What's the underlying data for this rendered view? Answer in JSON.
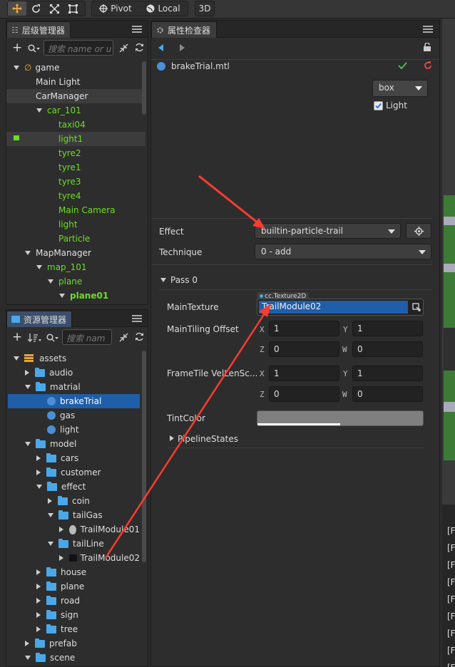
{
  "toolbar": {
    "pivot": "Pivot",
    "local": "Local",
    "mode3d": "3D"
  },
  "hierarchy": {
    "title": "层级管理器",
    "search_placeholder": "搜索 name or u",
    "nodes": [
      {
        "label": "game",
        "depth": 0,
        "arrow": "down",
        "color": "white",
        "icon": "fire"
      },
      {
        "label": "Main Light",
        "depth": 1,
        "arrow": "",
        "color": "white"
      },
      {
        "label": "CarManager",
        "depth": 1,
        "arrow": "",
        "color": "white",
        "state": "sel"
      },
      {
        "label": "car_101",
        "depth": 2,
        "arrow": "down",
        "color": "green"
      },
      {
        "label": "taxi04",
        "depth": 3,
        "arrow": "",
        "color": "green"
      },
      {
        "label": "light1",
        "depth": 3,
        "arrow": "",
        "color": "green",
        "state": "sel",
        "lock": true
      },
      {
        "label": "tyre2",
        "depth": 3,
        "arrow": "",
        "color": "green"
      },
      {
        "label": "tyre1",
        "depth": 3,
        "arrow": "",
        "color": "green"
      },
      {
        "label": "tyre3",
        "depth": 3,
        "arrow": "",
        "color": "green"
      },
      {
        "label": "tyre4",
        "depth": 3,
        "arrow": "",
        "color": "green"
      },
      {
        "label": "Main Camera",
        "depth": 3,
        "arrow": "",
        "color": "green"
      },
      {
        "label": "light",
        "depth": 3,
        "arrow": "",
        "color": "green"
      },
      {
        "label": "Particle",
        "depth": 3,
        "arrow": "",
        "color": "green"
      },
      {
        "label": "MapManager",
        "depth": 1,
        "arrow": "down",
        "color": "white"
      },
      {
        "label": "map_101",
        "depth": 2,
        "arrow": "down",
        "color": "green"
      },
      {
        "label": "plane",
        "depth": 3,
        "arrow": "down",
        "color": "green"
      },
      {
        "label": "plane01",
        "depth": 4,
        "arrow": "down",
        "color": "green"
      }
    ]
  },
  "assets": {
    "title": "资源管理器",
    "search_placeholder": "搜索 nam",
    "nodes": [
      {
        "label": "assets",
        "depth": 0,
        "arrow": "down",
        "icon": "db"
      },
      {
        "label": "audio",
        "depth": 1,
        "arrow": "right",
        "icon": "folder"
      },
      {
        "label": "matrial",
        "depth": 1,
        "arrow": "down",
        "icon": "folder"
      },
      {
        "label": "brakeTrial",
        "depth": 2,
        "arrow": "",
        "icon": "ball",
        "state": "blue"
      },
      {
        "label": "gas",
        "depth": 2,
        "arrow": "",
        "icon": "ball"
      },
      {
        "label": "light",
        "depth": 2,
        "arrow": "",
        "icon": "ball"
      },
      {
        "label": "model",
        "depth": 1,
        "arrow": "down",
        "icon": "folder"
      },
      {
        "label": "cars",
        "depth": 2,
        "arrow": "right",
        "icon": "folder"
      },
      {
        "label": "customer",
        "depth": 2,
        "arrow": "right",
        "icon": "folder"
      },
      {
        "label": "effect",
        "depth": 2,
        "arrow": "down",
        "icon": "folder"
      },
      {
        "label": "coin",
        "depth": 3,
        "arrow": "right",
        "icon": "folder"
      },
      {
        "label": "tailGas",
        "depth": 3,
        "arrow": "down",
        "icon": "folder"
      },
      {
        "label": "TrailModule01",
        "depth": 4,
        "arrow": "right",
        "icon": "smoke"
      },
      {
        "label": "tailLine",
        "depth": 3,
        "arrow": "down",
        "icon": "folder"
      },
      {
        "label": "TrailModule02",
        "depth": 4,
        "arrow": "right",
        "icon": "black"
      },
      {
        "label": "house",
        "depth": 2,
        "arrow": "right",
        "icon": "folder"
      },
      {
        "label": "plane",
        "depth": 2,
        "arrow": "right",
        "icon": "folder"
      },
      {
        "label": "road",
        "depth": 2,
        "arrow": "right",
        "icon": "folder"
      },
      {
        "label": "sign",
        "depth": 2,
        "arrow": "right",
        "icon": "folder"
      },
      {
        "label": "tree",
        "depth": 2,
        "arrow": "right",
        "icon": "folder"
      },
      {
        "label": "prefab",
        "depth": 1,
        "arrow": "right",
        "icon": "folder"
      },
      {
        "label": "scene",
        "depth": 1,
        "arrow": "down",
        "icon": "folder"
      }
    ]
  },
  "inspector": {
    "title": "属性检查器",
    "file": "brakeTrial.mtl",
    "preview_mesh": "box",
    "preview_light": "Light",
    "effect_label": "Effect",
    "effect_value": "builtin-particle-trail",
    "technique_label": "Technique",
    "technique_value": "0 - add",
    "pass_label": "Pass 0",
    "main_texture_label": "MainTexture",
    "texture_type": "cc.Texture2D",
    "main_texture_value": "TrailModule02",
    "tiling_label": "MainTiling Offset",
    "tiling": {
      "x": "1",
      "y": "1",
      "z": "0",
      "w": "0"
    },
    "frametile_label": "FrameTile VelLenSc...",
    "frametile": {
      "x": "1",
      "y": "1",
      "z": "0",
      "w": "0"
    },
    "tint_label": "TintColor",
    "pipeline_label": "PipelineStates"
  },
  "console": {
    "rows": [
      "[F",
      "[F",
      "[F",
      "[F",
      "[F",
      "[F",
      "[F",
      "[F",
      "[F"
    ]
  },
  "colors": {
    "accent_green": "#6ddc27",
    "selection_blue": "#1f5ea8",
    "annotation_red": "#ff3b30"
  }
}
